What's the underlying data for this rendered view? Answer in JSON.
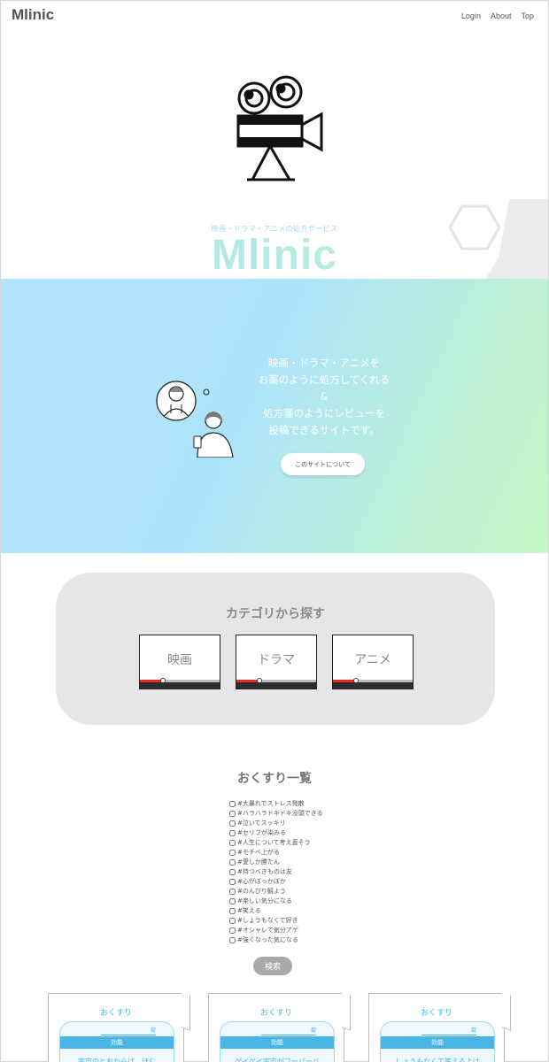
{
  "header": {
    "brand": "Mlinic",
    "nav": [
      "Login",
      "About",
      "Top"
    ]
  },
  "hero": {
    "tagline": "映画・ドラマ・アニメの処方サービス",
    "title": "Mlinic"
  },
  "intro": {
    "lines": [
      "映画・ドラマ・アニメを",
      "お薬のように処方してくれる",
      "&",
      "処方箋のようにレビューを",
      "投稿できるサイトです。"
    ],
    "about_button": "このサイトについて"
  },
  "categories": {
    "title": "カテゴリから探す",
    "items": [
      "映画",
      "ドラマ",
      "アニメ"
    ],
    "player_progress_fraction": 0.28
  },
  "medicine_list": {
    "title": "おくすり一覧",
    "options": [
      "#大暴れでストレス発散",
      "#ハラハラドキドキ没頭できる",
      "#泣いてスッキリ",
      "#セリフが染みる",
      "#人生について考え直そう",
      "#モチベ上がる",
      "#愛しか勝たん",
      "#持つべきものは友",
      "#心がぽっかぽか",
      "#のんびり観よう",
      "#楽しい気分になる",
      "#笑える",
      "#しょうもなくて好き",
      "#オシャレで気分アゲ",
      "#強くなった気になる"
    ],
    "search_button": "検索"
  },
  "prescriptions": [
    {
      "label": "おくすり",
      "unit": "錠",
      "effect": "効能",
      "text": "宇宙のとおからば、ほむ"
    },
    {
      "label": "おくすり",
      "unit": "錠",
      "effect": "効能",
      "text": "ゲイゲイ宇宙がフーパーバ"
    },
    {
      "label": "おくすり",
      "unit": "錠",
      "effect": "効能",
      "text": "しょうもなくて笑えるよは"
    }
  ],
  "colors": {
    "accent_blue": "#4ab6e6",
    "gradient_start": "#aee4fb",
    "gradient_end": "#c7f7c4",
    "category_bg": "#e6e6e6",
    "search_button": "#a9a9a9"
  }
}
